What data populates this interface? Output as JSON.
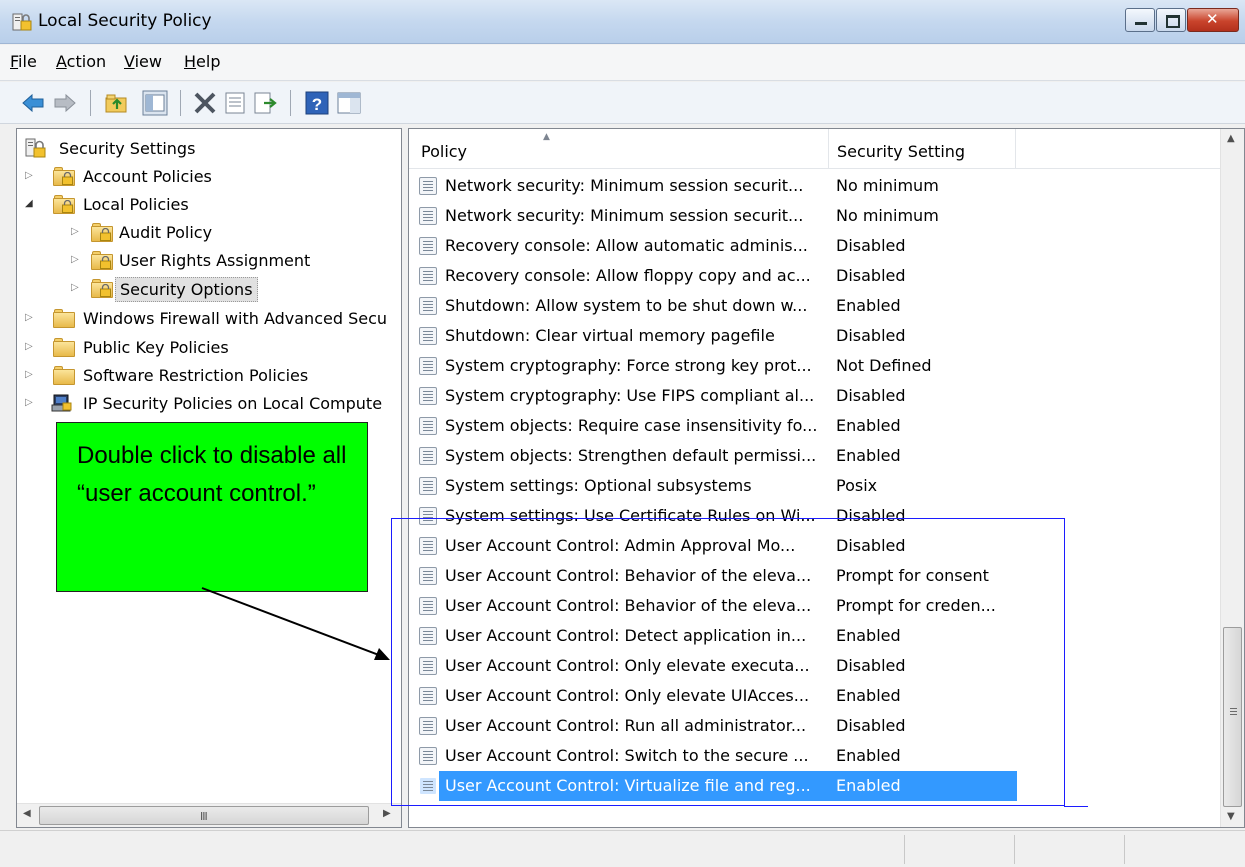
{
  "window": {
    "title": "Local Security Policy"
  },
  "menu": [
    {
      "key": "F",
      "rest": "ile"
    },
    {
      "key": "A",
      "rest": "ction"
    },
    {
      "key": "V",
      "rest": "iew"
    },
    {
      "key": "H",
      "rest": "elp"
    }
  ],
  "toolbar": {
    "icons": [
      "back-arrow-icon",
      "forward-arrow-icon",
      "up-folder-icon",
      "show-hide-tree-icon",
      "delete-icon",
      "properties-icon",
      "export-list-icon",
      "help-icon",
      "show-hide-action-pane-icon"
    ]
  },
  "tree": {
    "root": "Security Settings",
    "account_policies": "Account Policies",
    "local_policies": "Local Policies",
    "audit_policy": "Audit Policy",
    "user_rights": "User Rights Assignment",
    "security_options": "Security Options",
    "firewall": "Windows Firewall with Advanced Secu",
    "public_key": "Public Key Policies",
    "software_restriction": "Software Restriction Policies",
    "ip_security": "IP Security Policies on Local Compute"
  },
  "list": {
    "col_policy": "Policy",
    "col_setting": "Security Setting",
    "rows": [
      {
        "policy": "Network security: Minimum session securit...",
        "setting": "No minimum"
      },
      {
        "policy": "Network security: Minimum session securit...",
        "setting": "No minimum"
      },
      {
        "policy": "Recovery console: Allow automatic adminis...",
        "setting": "Disabled"
      },
      {
        "policy": "Recovery console: Allow floppy copy and ac...",
        "setting": "Disabled"
      },
      {
        "policy": "Shutdown: Allow system to be shut down w...",
        "setting": "Enabled"
      },
      {
        "policy": "Shutdown: Clear virtual memory pagefile",
        "setting": "Disabled"
      },
      {
        "policy": "System cryptography: Force strong key prot...",
        "setting": "Not Defined"
      },
      {
        "policy": "System cryptography: Use FIPS compliant al...",
        "setting": "Disabled"
      },
      {
        "policy": "System objects: Require case insensitivity fo...",
        "setting": "Enabled"
      },
      {
        "policy": "System objects: Strengthen default permissi...",
        "setting": "Enabled"
      },
      {
        "policy": "System settings: Optional subsystems",
        "setting": "Posix"
      },
      {
        "policy": "System settings: Use Certificate Rules on Wi...",
        "setting": "Disabled"
      },
      {
        "policy": "User Account Control: Admin Approval Mo...",
        "setting": "Disabled"
      },
      {
        "policy": "User Account Control: Behavior of the eleva...",
        "setting": "Prompt for consent"
      },
      {
        "policy": "User Account Control: Behavior of the eleva...",
        "setting": "Prompt for creden..."
      },
      {
        "policy": "User Account Control: Detect application in...",
        "setting": "Enabled"
      },
      {
        "policy": "User Account Control: Only elevate executa...",
        "setting": "Disabled"
      },
      {
        "policy": "User Account Control: Only elevate UIAcces...",
        "setting": "Enabled"
      },
      {
        "policy": "User Account Control: Run all administrator...",
        "setting": "Disabled"
      },
      {
        "policy": "User Account Control: Switch to the secure ...",
        "setting": "Enabled"
      },
      {
        "policy": "User Account Control: Virtualize file and reg...",
        "setting": "Enabled"
      }
    ],
    "selected_index": 20
  },
  "annotation": {
    "callout_text": "Double click to disable all “user account control.”",
    "callout_color": "#00ff00",
    "box_color": "#1c1cff"
  },
  "colors": {
    "selection": "#3399ff"
  }
}
